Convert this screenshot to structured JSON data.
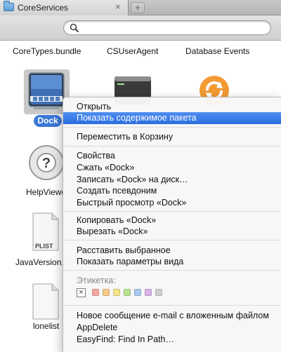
{
  "window": {
    "tab_title": "CoreServices",
    "tab_close": "×",
    "new_tab": "+",
    "search_placeholder": ""
  },
  "items": {
    "row1": [
      "CoreTypes.bundle",
      "CSUserAgent",
      "Database Events"
    ],
    "dock": "Dock",
    "helpviewer": "HelpViewe",
    "javaversion": "JavaVersion.p",
    "plist_badge": "PLIST",
    "lonelist": "lonelist"
  },
  "context_menu": {
    "open": "Открыть",
    "show_contents": "Показать содержимое пакета",
    "move_to_trash": "Переместить в Корзину",
    "get_info": "Свойства",
    "compress": "Сжать «Dock»",
    "burn": "Записать «Dock» на диск…",
    "make_alias": "Создать псевдоним",
    "quick_look": "Быстрый просмотр «Dock»",
    "copy": "Копировать «Dock»",
    "cut": "Вырезать «Dock»",
    "arrange": "Расставить выбранное",
    "view_options": "Показать параметры вида",
    "labels_header": "Этикетка:",
    "label_none": "×",
    "label_colors": [
      "#f4a6a0",
      "#f7c98a",
      "#f3e58a",
      "#b8e28e",
      "#a9c8f0",
      "#d7b4e8",
      "#cfcfcf"
    ],
    "new_email": "Новое сообщение e-mail с вложенным файлом",
    "appdelete": "AppDelete",
    "easyfind": "EasyFind: Find In Path…"
  },
  "colors": {
    "highlight": "#3b7be6",
    "selection_badge": "#3b78d8"
  }
}
